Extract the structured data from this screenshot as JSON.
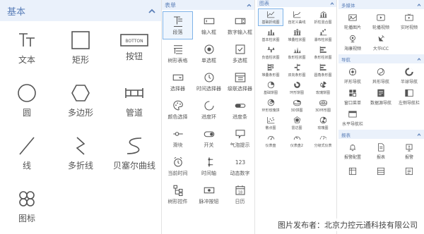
{
  "basic": {
    "title": "基本",
    "items": [
      {
        "label": "文本"
      },
      {
        "label": "矩形"
      },
      {
        "label": "按钮"
      },
      {
        "label": "圆"
      },
      {
        "label": "多边形"
      },
      {
        "label": "管道"
      },
      {
        "label": "线"
      },
      {
        "label": "多折线"
      },
      {
        "label": "贝塞尔曲线"
      },
      {
        "label": "图标"
      }
    ],
    "button_icon_text": "BOTTON"
  },
  "form": {
    "title": "表单",
    "items": [
      {
        "label": "段落"
      },
      {
        "label": "输入框"
      },
      {
        "label": "数字输入框"
      },
      {
        "label": "树形表格"
      },
      {
        "label": "单选框"
      },
      {
        "label": "多选框"
      },
      {
        "label": "选择器"
      },
      {
        "label": "时间选择器"
      },
      {
        "label": "级联选择器"
      },
      {
        "label": "颜色选择"
      },
      {
        "label": "进度环"
      },
      {
        "label": "进度条"
      },
      {
        "label": "滑块"
      },
      {
        "label": "开关"
      },
      {
        "label": "气泡提示"
      },
      {
        "label": "当前时间"
      },
      {
        "label": "时间轴"
      },
      {
        "label": "动态数字"
      },
      {
        "label": "树形控件"
      },
      {
        "label": "脉冲按钮"
      },
      {
        "label": "日历"
      }
    ],
    "number_icon_text": "123",
    "calendar_icon_text": "18"
  },
  "chart": {
    "title": "图表",
    "items": [
      {
        "label": "基础折线图"
      },
      {
        "label": "自定义曲线"
      },
      {
        "label": "折柱混合图"
      },
      {
        "label": "基本柱状图"
      },
      {
        "label": "堆叠柱状图"
      },
      {
        "label": "瀑布柱状图"
      },
      {
        "label": "负值柱状图"
      },
      {
        "label": "象形柱状图"
      },
      {
        "label": "条形柱状图"
      },
      {
        "label": "堆叠条形图"
      },
      {
        "label": "双向条形图"
      },
      {
        "label": "圆角条形图"
      },
      {
        "label": "基础饼图"
      },
      {
        "label": "环形饼图"
      },
      {
        "label": "玫瑰饼图"
      },
      {
        "label": "环形玫瑰饼"
      },
      {
        "label": "3D饼图"
      },
      {
        "label": "3D环形图"
      },
      {
        "label": "散点图"
      },
      {
        "label": "雷达图"
      },
      {
        "label": "玫瑰图"
      },
      {
        "label": "仪表盘"
      },
      {
        "label": "仪表盘2"
      },
      {
        "label": "分级式仪表"
      }
    ]
  },
  "media": {
    "title": "多媒体",
    "items": [
      {
        "label": "轮播图片"
      },
      {
        "label": "轮播视频"
      },
      {
        "label": "实时视频"
      },
      {
        "label": "海康视频"
      },
      {
        "label": "大华ICC"
      }
    ]
  },
  "nav": {
    "title": "导航",
    "items": [
      {
        "label": "环形导航"
      },
      {
        "label": "异形导航"
      },
      {
        "label": "半球导航"
      },
      {
        "label": "窗口菜单"
      },
      {
        "label": "数据源导航"
      },
      {
        "label": "左侧导航栏"
      },
      {
        "label": "水平导航栏"
      }
    ]
  },
  "report": {
    "title": "报表",
    "items": [
      {
        "label": "报警配置"
      },
      {
        "label": "报表"
      },
      {
        "label": "报警"
      },
      {
        "label": ""
      },
      {
        "label": ""
      },
      {
        "label": ""
      }
    ]
  },
  "watermark": "图片发布者：北京力控元通科技有限公司",
  "colors": {
    "accent": "#5b7fb8",
    "header_bg": "#eaf1fb",
    "selected_border": "#7fb3e8",
    "icon": "#555555"
  }
}
